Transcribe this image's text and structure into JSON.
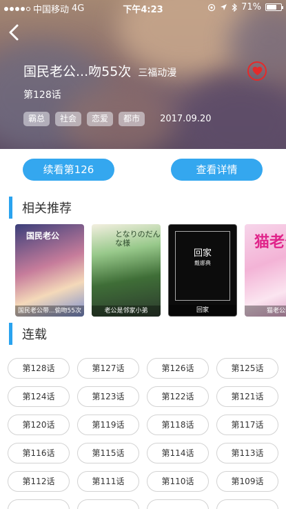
{
  "status_bar": {
    "carrier": "中国移动",
    "network": "4G",
    "time": "下午4:23",
    "battery": "71%",
    "battery_level": 0.71
  },
  "comic": {
    "title": "国民老公...吻55次",
    "author": "三福动漫",
    "chapter": "第128话",
    "tags": [
      "霸总",
      "社会",
      "恋爱",
      "都市"
    ],
    "date": "2017.09.20"
  },
  "actions": {
    "continue_label": "续看第126",
    "detail_label": "查看详情"
  },
  "recommend": {
    "title": "相关推荐",
    "items": [
      {
        "caption": "国民老公带...偷吻55次",
        "cover_text": "国民老公"
      },
      {
        "caption": "老公是邻家小弟",
        "cover_text": "となりのだんな様"
      },
      {
        "caption": "回家",
        "cover_text": "回家",
        "cover_subtext": "戴娜典"
      },
      {
        "caption": "猫老公猫",
        "cover_text": "猫老公"
      }
    ]
  },
  "serial": {
    "title": "连载",
    "chapters": [
      "第128话",
      "第127话",
      "第126话",
      "第125话",
      "第124话",
      "第123话",
      "第122话",
      "第121话",
      "第120话",
      "第119话",
      "第118话",
      "第117话",
      "第116话",
      "第115话",
      "第114话",
      "第113话",
      "第112话",
      "第111话",
      "第110话",
      "第109话",
      "",
      "",
      "",
      ""
    ]
  },
  "colors": {
    "accent": "#34a7ef",
    "favorite": "#e52a2a"
  },
  "icons": {
    "back": "chevron-left-icon",
    "favorite": "heart-icon"
  }
}
